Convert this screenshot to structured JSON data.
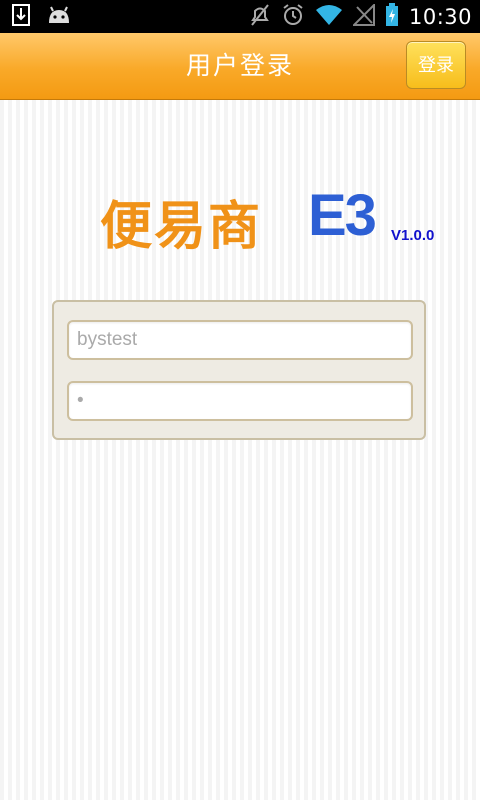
{
  "status_bar": {
    "time": "10:30",
    "icons": [
      "download-icon",
      "android-icon",
      "mute-icon",
      "alarm-icon",
      "wifi-icon",
      "signal-icon",
      "battery-charging-icon"
    ]
  },
  "header": {
    "title": "用户登录",
    "login_button": "登录"
  },
  "logo": {
    "cn_text": "便易商",
    "e3_text": "E3",
    "version": "V1.0.0"
  },
  "login_form": {
    "username_value": "bystest",
    "password_value": "•"
  },
  "colors": {
    "header_orange": "#f9a928",
    "logo_orange": "#f09218",
    "logo_blue": "#2d5fd4",
    "version_blue": "#1111cc"
  }
}
